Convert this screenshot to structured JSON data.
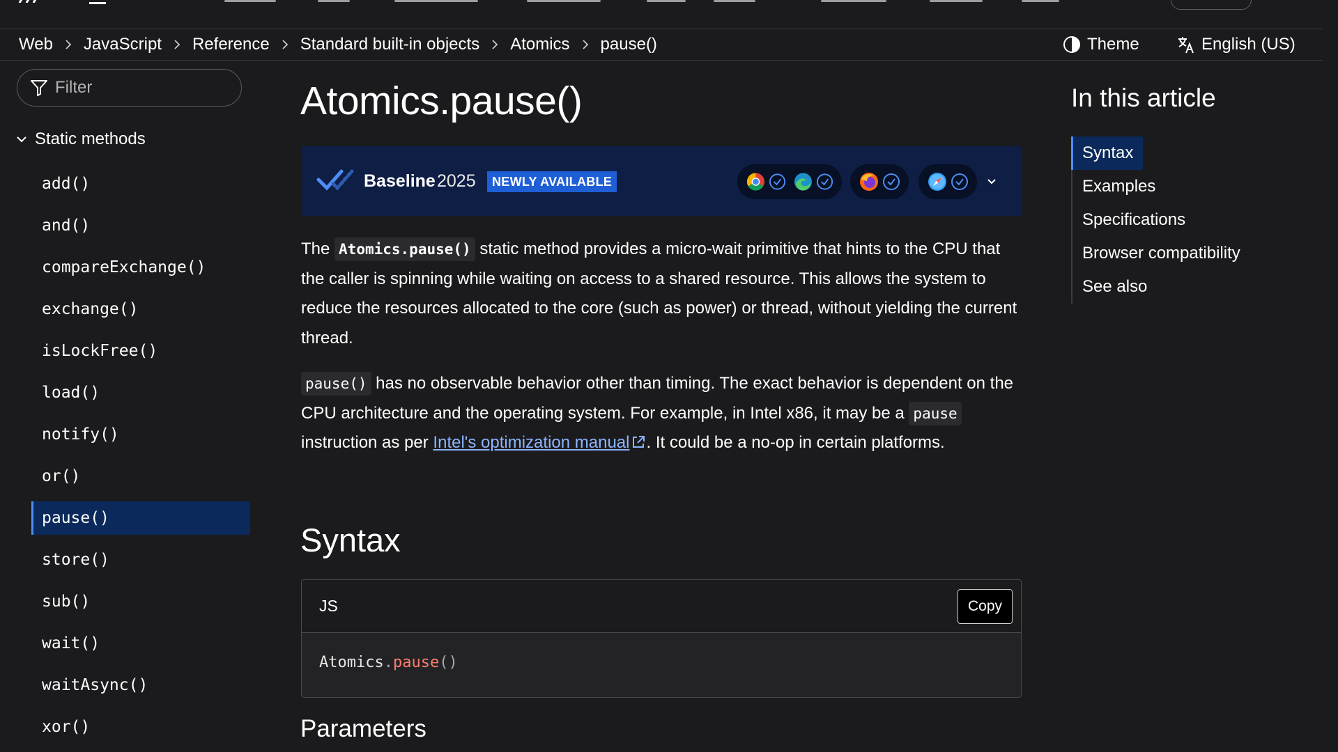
{
  "breadcrumb": [
    "Web",
    "JavaScript",
    "Reference",
    "Standard built-in objects",
    "Atomics",
    "pause()"
  ],
  "header_actions": {
    "theme_label": "Theme",
    "language_label": "English (US)"
  },
  "sidebar": {
    "filter_placeholder": "Filter",
    "section_title": "Static methods",
    "items": [
      "add()",
      "and()",
      "compareExchange()",
      "exchange()",
      "isLockFree()",
      "load()",
      "notify()",
      "or()",
      "pause()",
      "store()",
      "sub()",
      "wait()",
      "waitAsync()",
      "xor()"
    ],
    "active_item": "pause()"
  },
  "article": {
    "title": "Atomics.pause()",
    "baseline": {
      "label": "Baseline",
      "year": "2025",
      "badge": "NEWLY AVAILABLE",
      "browsers": [
        "chrome-icon",
        "edge-icon",
        "firefox-icon",
        "safari-icon"
      ]
    },
    "intro": {
      "p1_before": "The ",
      "p1_code": "Atomics.pause()",
      "p1_after": " static method provides a micro-wait primitive that hints to the CPU that the caller is spinning while waiting on access to a shared resource. This allows the system to reduce the resources allocated to the core (such as power) or thread, without yielding the current thread.",
      "p2_code1": "pause()",
      "p2_mid": " has no observable behavior other than timing. The exact behavior is dependent on the CPU architecture and the operating system. For example, in Intel x86, it may be a ",
      "p2_code2": "pause",
      "p2_before_link": " instruction as per ",
      "p2_link": "Intel's optimization manual",
      "p2_after": ". It could be a no-op in certain platforms."
    },
    "syntax_heading": "Syntax",
    "code_block": {
      "language": "JS",
      "copy_label": "Copy",
      "code_object": "Atomics",
      "code_dot": ".",
      "code_method": "pause",
      "code_parens": "()"
    },
    "parameters_heading": "Parameters"
  },
  "toc": {
    "title": "In this article",
    "items": [
      "Syntax",
      "Examples",
      "Specifications",
      "Browser compatibility",
      "See also"
    ],
    "active_item": "Syntax"
  },
  "colors": {
    "background": "#1b1b1d",
    "active_bg": "#0b2a5b",
    "accent": "#4e8df5",
    "baseline_bg": "#0e1e45",
    "badge_bg": "#1f5fd6",
    "link": "#8cb4ff"
  }
}
